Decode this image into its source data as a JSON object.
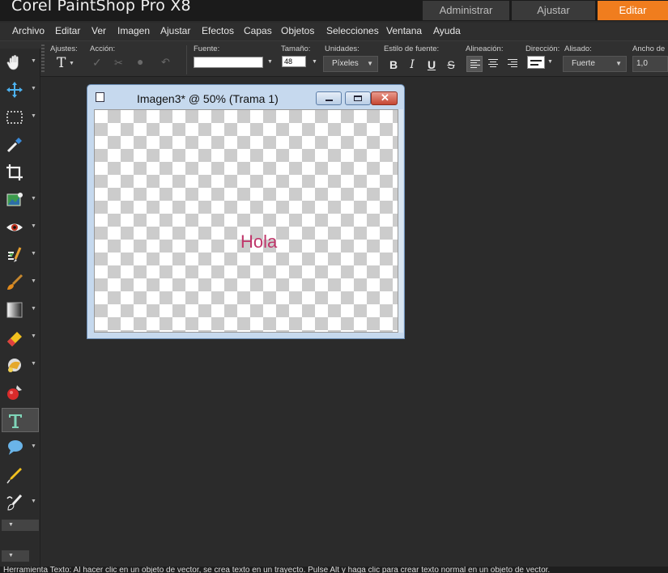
{
  "app": {
    "title": "Corel PaintShop Pro X8"
  },
  "workspace_tabs": [
    {
      "label": "Administrar"
    },
    {
      "label": "Ajustar"
    },
    {
      "label": "Editar",
      "active": true
    }
  ],
  "menu": [
    "Archivo",
    "Editar",
    "Ver",
    "Imagen",
    "Ajustar",
    "Efectos",
    "Capas",
    "Objetos",
    "Selecciones",
    "Ventana",
    "Ayuda"
  ],
  "tool_options": {
    "presets_label": "Ajustes:",
    "action_label": "Acción:",
    "font_label": "Fuente:",
    "font_value": "",
    "size_label": "Tamaño:",
    "size_value": "48",
    "units_label": "Unidades:",
    "units_value": "Píxeles",
    "font_style_label": "Estilo de fuente:",
    "bold": "B",
    "italic": "I",
    "underline": "U",
    "strike": "S",
    "alignment_label": "Alineación:",
    "direction_label": "Dirección:",
    "antialias_label": "Alisado:",
    "antialias_value": "Fuerte",
    "stroke_width_label": "Ancho de",
    "stroke_width_value": "1,0"
  },
  "tools": [
    {
      "name": "pan-tool-icon"
    },
    {
      "name": "move-tool-icon"
    },
    {
      "name": "selection-tool-icon"
    },
    {
      "name": "dropper-tool-icon"
    },
    {
      "name": "crop-tool-icon"
    },
    {
      "name": "straighten-tool-icon"
    },
    {
      "name": "red-eye-tool-icon"
    },
    {
      "name": "clone-brush-tool-icon"
    },
    {
      "name": "paint-brush-tool-icon"
    },
    {
      "name": "gradient-tool-icon"
    },
    {
      "name": "eraser-tool-icon"
    },
    {
      "name": "flood-fill-tool-icon"
    },
    {
      "name": "color-changer-tool-icon"
    },
    {
      "name": "text-tool-icon",
      "active": true
    },
    {
      "name": "preset-shape-tool-icon"
    },
    {
      "name": "pen-tool-icon"
    },
    {
      "name": "warp-brush-tool-icon"
    }
  ],
  "image_window": {
    "caption": "Imagen3* @  50% (Trama 1)",
    "canvas_text": "Hola",
    "canvas_text_color": "#c0366a"
  },
  "status": {
    "text": "Herramienta Texto: Al hacer clic en un objeto de vector, se crea texto en un trayecto. Pulse Alt y haga clic para crear texto normal en un objeto de vector."
  },
  "colors": {
    "accent": "#f07d1e",
    "background": "#2b2b2b"
  }
}
